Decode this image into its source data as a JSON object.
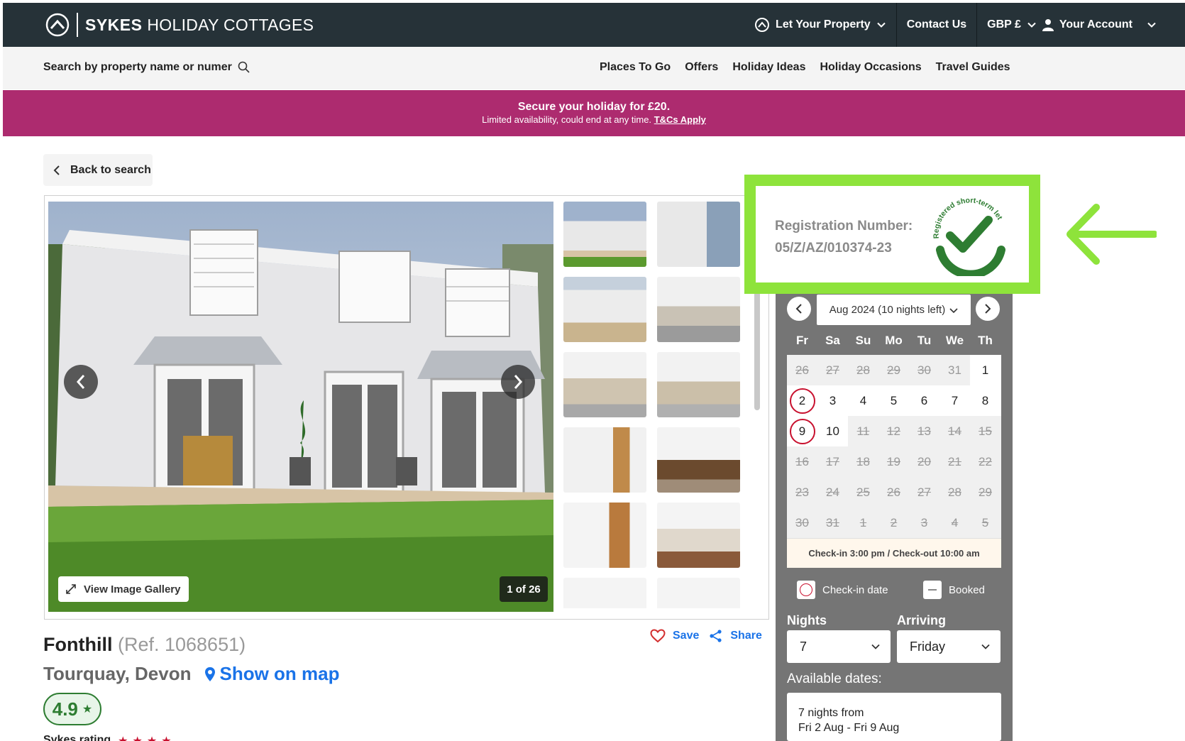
{
  "header": {
    "brand_bold": "SYKES",
    "brand_thin": "HOLIDAY COTTAGES",
    "let_property": "Let Your Property",
    "contact": "Contact Us",
    "currency": "GBP £",
    "account": "Your Account"
  },
  "subnav": {
    "search_placeholder": "Search by property name or numer",
    "links": [
      "Places To Go",
      "Offers",
      "Holiday Ideas",
      "Holiday Occasions",
      "Travel Guides"
    ]
  },
  "promo": {
    "line1": "Secure your holiday for £20.",
    "line2": "Limited availability, could end at any time.",
    "link": "T&Cs Apply"
  },
  "back_label": "Back to search",
  "gallery": {
    "view_label": "View Image Gallery",
    "counter": "1 of 26"
  },
  "registration": {
    "label": "Registration Number:",
    "number": "05/Z/AZ/010374-23",
    "badge_text": "Registered short-term let"
  },
  "calendar": {
    "month": "Aug 2024 (10 nights left)",
    "weekdays": [
      "Fr",
      "Sa",
      "Su",
      "Mo",
      "Tu",
      "We",
      "Th"
    ],
    "rows": [
      [
        "26",
        "27",
        "28",
        "29",
        "30",
        "31",
        "1"
      ],
      [
        "2",
        "3",
        "4",
        "5",
        "6",
        "7",
        "8"
      ],
      [
        "9",
        "10",
        "11",
        "12",
        "13",
        "14",
        "15"
      ],
      [
        "16",
        "17",
        "18",
        "19",
        "20",
        "21",
        "22"
      ],
      [
        "23",
        "24",
        "25",
        "26",
        "27",
        "28",
        "29"
      ],
      [
        "30",
        "31",
        "1",
        "2",
        "3",
        "4",
        "5"
      ]
    ],
    "check_times": "Check-in 3:00 pm / Check-out 10:00 am",
    "legend_checkin": "Check-in date",
    "legend_booked": "Booked",
    "nights_label": "Nights",
    "nights_value": "7",
    "arriving_label": "Arriving",
    "arriving_value": "Friday",
    "available_label": "Available dates:",
    "avail_line1": "7 nights from",
    "avail_line2": "Fri 2 Aug - Fri 9 Aug"
  },
  "property": {
    "name": "Fonthill",
    "ref": "(Ref. 1068651)",
    "location": "Tourquay, Devon",
    "map_link": "Show on map",
    "save": "Save",
    "share": "Share",
    "rating": "4.9",
    "sykes_rating": "Sykes rating"
  },
  "colors": {
    "header_bg": "#263238",
    "promo_bg": "#ad2b6f",
    "highlight": "#8ee33b",
    "badge_green": "#2e7d32",
    "link_blue": "#1a73e8",
    "calendar_bg": "#757575"
  }
}
